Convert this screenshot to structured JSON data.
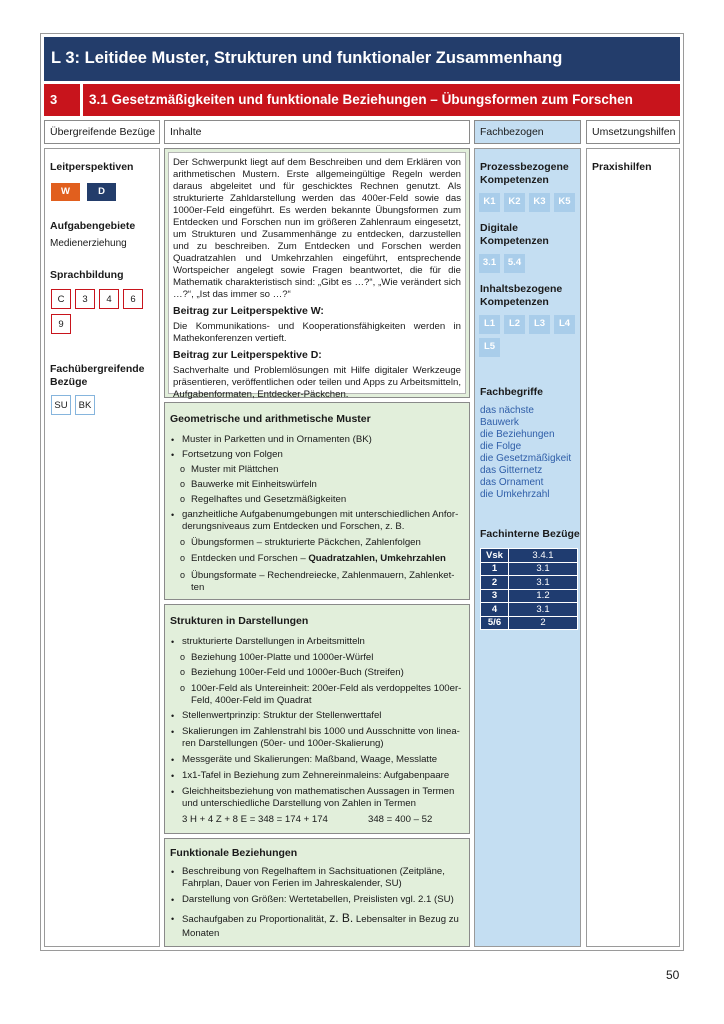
{
  "title": "L 3: Leitidee Muster, Strukturen und funktionaler Zusammenhang",
  "subtitle_num": "3",
  "subtitle": "3.1 Gesetzmäßigkeiten und funktionale Beziehungen – Übungsformen zum Forschen",
  "headers": {
    "a": "Übergreifende Bezüge",
    "b": "Inhalte",
    "c": "Fachbezogen",
    "d": "Umsetzungshilfen"
  },
  "left": {
    "leitperspektiven_h": "Leitperspektiven",
    "chips": [
      {
        "label": "W",
        "color": "#e15f1e"
      },
      {
        "label": "D",
        "color": "#233d6b"
      }
    ],
    "aufgaben_h": "Aufgabengebiete",
    "aufgaben_t": "Medienerziehung",
    "sprach_h": "Sprachbildung",
    "sprach": [
      "C",
      "3",
      "4",
      "6",
      "9"
    ],
    "fach_h1": "Fachübergreifende",
    "fach_h2": "Bezüge",
    "fach": [
      "SU",
      "BK"
    ]
  },
  "intro": {
    "text": "Der Schwerpunkt liegt auf dem Beschreiben und dem Erklären von arithmetischen Mustern. Erste allgemeingültige Regeln werden daraus abgeleitet und für geschicktes Rechnen genutzt. Als strukturierte Zahldarstellung werden das 400er-Feld sowie das 1000er-Feld eingeführt. Es werden bekannte Übungsformen zum Entdecken und Forschen nun im größeren Zahlenraum eingesetzt, um Strukturen und Zusammenhänge zu entdecken, darzustellen und zu beschreiben. Zum Entdecken und Forschen werden Quadratzahlen und Umkehrzahlen eingeführt, entsprechende Wortspeicher angelegt sowie Fragen beantwortet, die für die Mathematik charakteristisch sind: „Gibt es …?“, „Wie verändert sich …?“, „Ist das immer so …?“",
    "w_h": "Beitrag zur Leitperspektive W:",
    "w_t": "Die Kommunikations- und Kooperationsfähigkeiten werden in Mathekonferenzen vertieft.",
    "d_h": "Beitrag zur Leitperspektive D:",
    "d_t": "Sachverhalte und Problemlösungen mit Hilfe digitaler Werkzeuge präsentieren, veröffentlichen oder teilen und Apps zu Arbeitsmitteln, Aufgabenformaten, Entdecker-Päckchen."
  },
  "geo": {
    "h": "Geometrische und arithmetische Muster",
    "l1": "Muster in Parketten und in Ornamenten (BK)",
    "l2": "Fortsetzung von Folgen",
    "l2a": "Muster mit Plättchen",
    "l2b": "Bauwerke mit Einheitswürfeln",
    "l2c": "Regelhaftes und Gesetzmäßigkeiten",
    "l3a": "ganzheitliche Aufgabenumgebungen mit unterschiedlichen Anfor-",
    "l3b": "derungsniveaus zum Entdecken und Forschen, z. B.",
    "l3i": "Übungsformen – strukturierte Päckchen, Zahlenfolgen",
    "l3ii_a": "Entdecken und Forschen – ",
    "l3ii_b": "Quadratzahlen, Umkehrzahlen",
    "l3iii_a": "Übungsformate – Rechendreiecke, Zahlenmauern, Zahlenket-",
    "l3iii_b": "ten"
  },
  "struct": {
    "h": "Strukturen in Darstellungen",
    "l1": "strukturierte Darstellungen in Arbeitsmitteln",
    "l1a": "Beziehung 100er-Platte und 1000er-Würfel",
    "l1b": "Beziehung 100er-Feld und 1000er-Buch (Streifen)",
    "l1c1": "100er-Feld als Untereinheit: 200er-Feld als verdoppeltes 100er-",
    "l1c2": "Feld, 400er-Feld im Quadrat",
    "l2": "Stellenwertprinzip: Struktur der Stellenwerttafel",
    "l3a": "Skalierungen im Zahlenstrahl bis 1000 und Ausschnitte von linea-",
    "l3b": "ren Darstellungen (50er- und 100er-Skalierung)",
    "l4": "Messgeräte und Skalierungen: Maßband, Waage, Messlatte",
    "l5": "1x1-Tafel in Beziehung zum Zehnereinmaleins: Aufgabenpaare",
    "l6a": "Gleichheitsbeziehung von mathematischen Aussagen in Termen",
    "l6b": "und unterschiedliche Darstellung von Zahlen in Termen",
    "eq1": "3 H + 4 Z + 8 E = 348 = 174 + 174",
    "eq2": "348 = 400 – 52"
  },
  "func": {
    "h": "Funktionale Beziehungen",
    "l1a": "Beschreibung von Regelhaftem in Sachsituationen (Zeitpläne,",
    "l1b": "Fahrplan, Dauer von Ferien im Jahreskalender, SU)",
    "l2": "Darstellung von Größen: Wertetabellen, Preislisten vgl. 2.1 (SU)",
    "l3a": "Sachaufgaben zu Proportionalität, ",
    "l3zb": "z. B.",
    "l3c": " Lebensalter in Bezug zu",
    "l3d": "Monaten"
  },
  "fach": {
    "proz_h1": "Prozessbezogene",
    "proz_h2": "Kompetenzen",
    "proz": [
      "K1",
      "K2",
      "K3",
      "K5"
    ],
    "dig_h1": "Digitale",
    "dig_h2": "Kompetenzen",
    "dig": [
      "3.1",
      "5.4"
    ],
    "inh_h1": "Inhaltsbezogene",
    "inh_h2": "Kompetenzen",
    "inh": [
      "L1",
      "L2",
      "L3",
      "L4",
      "L5"
    ],
    "begriffe_h": "Fachbegriffe",
    "begriffe": [
      "das nächste",
      "Bauwerk",
      "die Beziehungen",
      "die Folge",
      "die Gesetzmäßigkeit",
      "das Gitternetz",
      "das Ornament",
      "die Umkehrzahl"
    ],
    "intern_h": "Fachinterne Bezüge",
    "vsk": [
      [
        "Vsk",
        "3.4.1"
      ],
      [
        "1",
        "3.1"
      ],
      [
        "2",
        "3.1"
      ],
      [
        "3",
        "1.2"
      ],
      [
        "4",
        "3.1"
      ],
      [
        "5/6",
        "2"
      ]
    ]
  },
  "ums": {
    "h": "Praxishilfen"
  },
  "page": "50"
}
